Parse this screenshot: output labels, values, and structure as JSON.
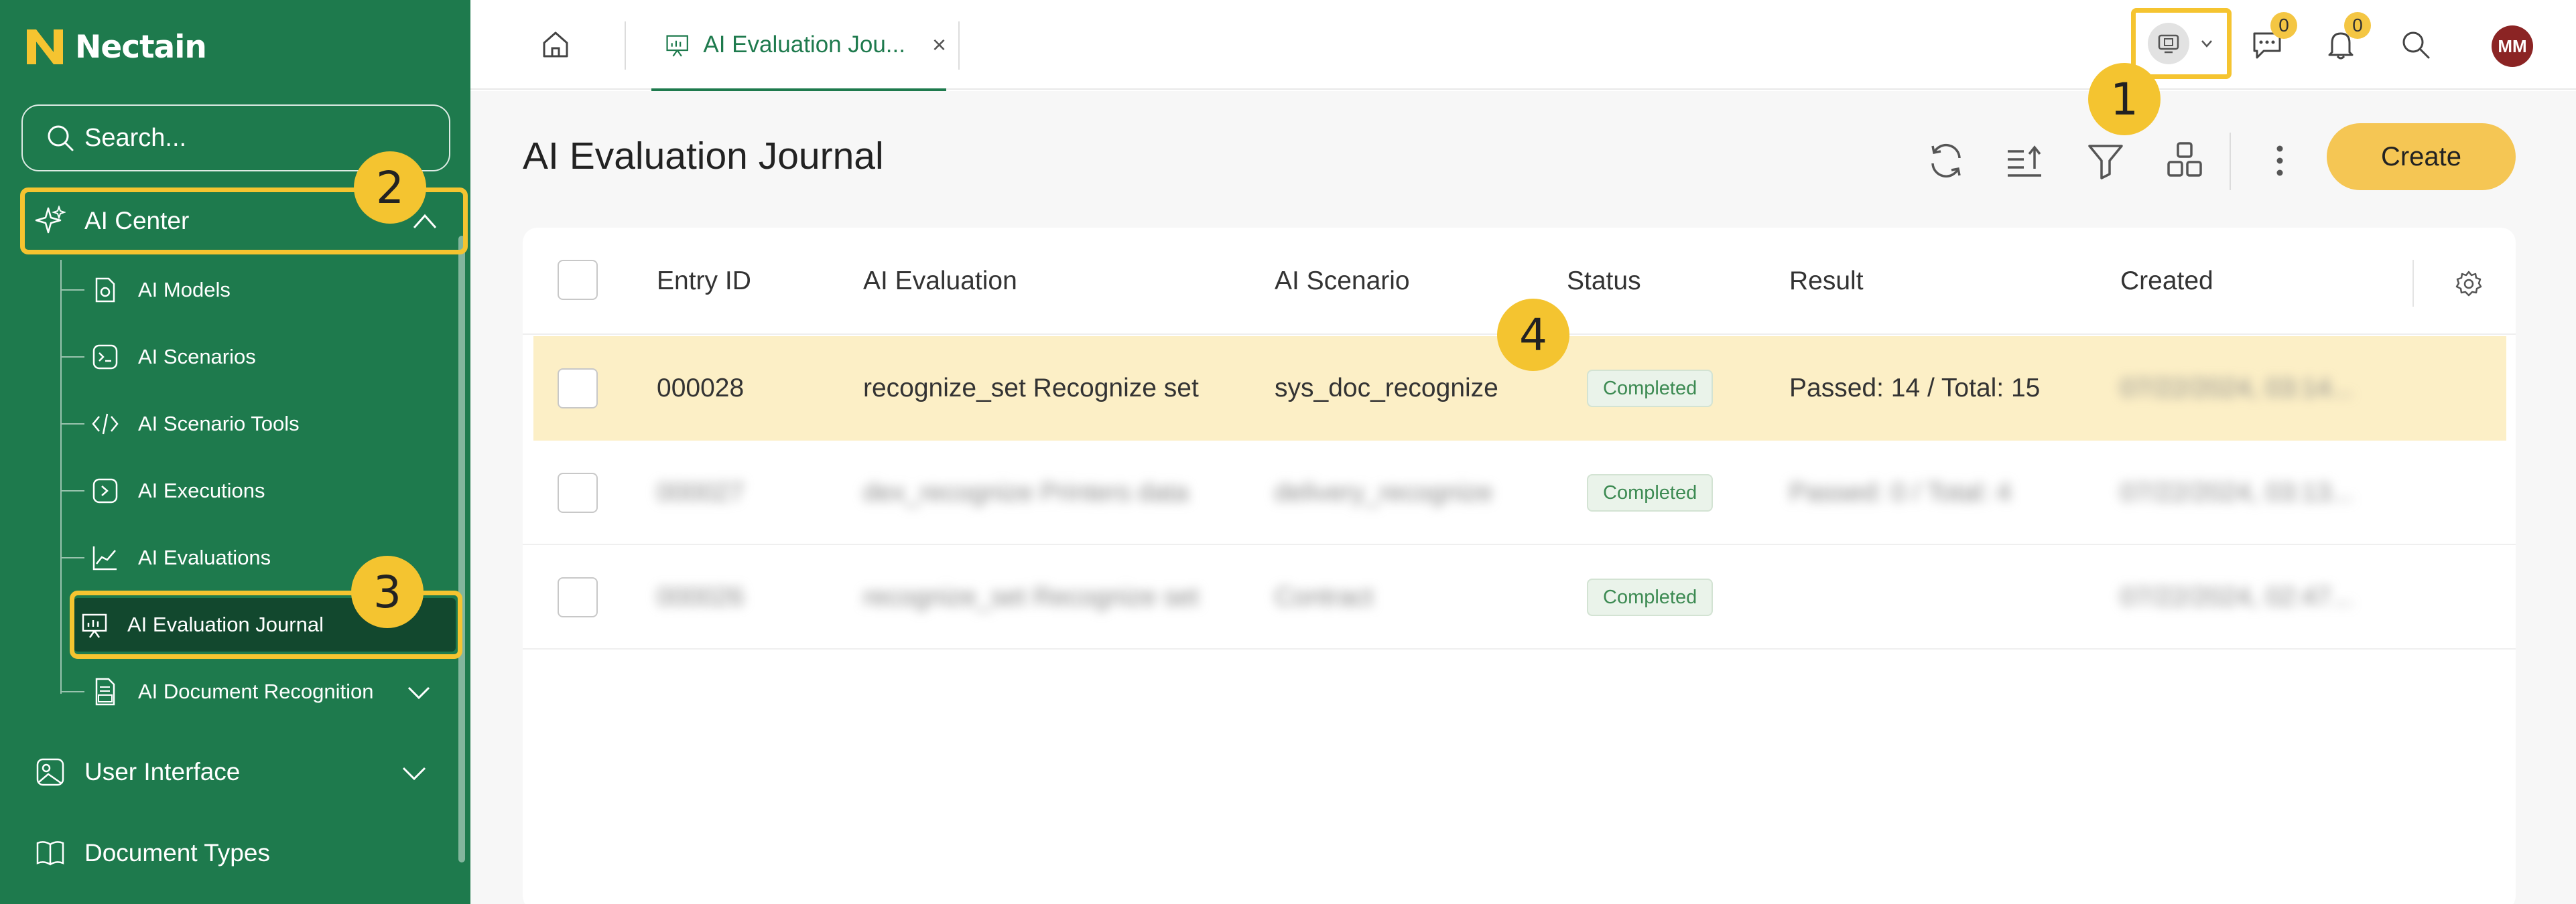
{
  "app": {
    "name": "Nectain"
  },
  "colors": {
    "sidebar": "#1e7a4d",
    "accent": "#f5c430",
    "active_item": "#12482e",
    "status_green": "#3c8a52"
  },
  "search": {
    "placeholder": "Search..."
  },
  "sidebar": {
    "group": {
      "label": "AI Center",
      "icon": "sparkles-icon",
      "expanded": true
    },
    "sub_items": [
      {
        "label": "AI Models",
        "icon": "model-icon"
      },
      {
        "label": "AI Scenarios",
        "icon": "terminal-icon"
      },
      {
        "label": "AI Scenario Tools",
        "icon": "code-icon"
      },
      {
        "label": "AI Executions",
        "icon": "execute-icon"
      },
      {
        "label": "AI Evaluations",
        "icon": "line-chart-icon"
      },
      {
        "label": "AI Evaluation Journal",
        "icon": "presentation-icon",
        "active": true
      },
      {
        "label": "AI Document Recognition",
        "icon": "idp-document-icon"
      }
    ],
    "main_items": [
      {
        "label": "User Interface",
        "icon": "image-icon"
      },
      {
        "label": "Document Types",
        "icon": "book-icon"
      }
    ]
  },
  "topbar": {
    "tab_label": "AI Evaluation Jou...",
    "tab_close": "×",
    "chat_count": "0",
    "notification_count": "0",
    "avatar_initials": "MM"
  },
  "page": {
    "title": "AI Evaluation Journal",
    "create_label": "Create"
  },
  "table": {
    "columns": [
      "Entry ID",
      "AI Evaluation",
      "AI Scenario",
      "Status",
      "Result",
      "Created"
    ],
    "rows": [
      {
        "entry_id": "000028",
        "evaluation": "recognize_set Recognize set",
        "scenario": "sys_doc_recognize",
        "status": "Completed",
        "result": "Passed: 14 / Total: 15",
        "created": "07/22/2024, 03:14..."
      },
      {
        "entry_id": "000027",
        "evaluation": "dex_recognize Printers data",
        "scenario": "delivery_recognize",
        "status": "Completed",
        "result": "Passed: 0 / Total: 4",
        "created": "07/22/2024, 03:13..."
      },
      {
        "entry_id": "000026",
        "evaluation": "recognize_set Recognize set",
        "scenario": "Contract",
        "status": "Completed",
        "result": "",
        "created": "07/22/2024, 02:47..."
      }
    ]
  },
  "callouts": [
    "1",
    "2",
    "3",
    "4"
  ]
}
